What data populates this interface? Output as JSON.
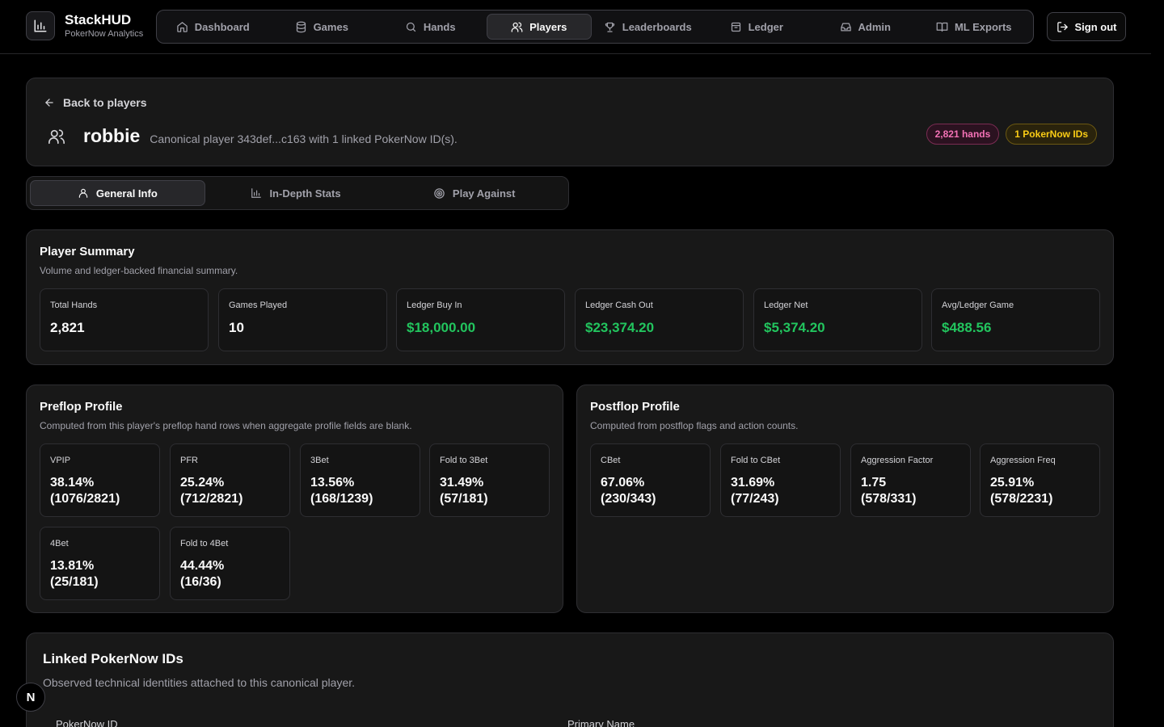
{
  "brand": {
    "title": "StackHUD",
    "subtitle": "PokerNow Analytics"
  },
  "nav": {
    "items": [
      {
        "label": "Dashboard",
        "icon": "home-icon"
      },
      {
        "label": "Games",
        "icon": "database-icon"
      },
      {
        "label": "Hands",
        "icon": "search-icon"
      },
      {
        "label": "Players",
        "icon": "users-icon",
        "active": true
      },
      {
        "label": "Leaderboards",
        "icon": "trophy-icon"
      },
      {
        "label": "Ledger",
        "icon": "wallet-icon"
      },
      {
        "label": "Admin",
        "icon": "inbox-icon"
      },
      {
        "label": "ML Exports",
        "icon": "book-icon"
      }
    ],
    "sign_out": "Sign out"
  },
  "hero": {
    "back_label": "Back to players",
    "player_name": "robbie",
    "description": "Canonical player 343def...c163 with 1 linked PokerNow ID(s).",
    "badge_hands": "2,821 hands",
    "badge_ids": "1 PokerNow IDs"
  },
  "tabs": [
    {
      "label": "General Info",
      "icon": "user-icon",
      "active": true
    },
    {
      "label": "In-Depth Stats",
      "icon": "bar-chart-icon"
    },
    {
      "label": "Play Against",
      "icon": "target-icon"
    }
  ],
  "summary": {
    "title": "Player Summary",
    "subtitle": "Volume and ledger-backed financial summary.",
    "stats": [
      {
        "label": "Total Hands",
        "value": "2,821"
      },
      {
        "label": "Games Played",
        "value": "10"
      },
      {
        "label": "Ledger Buy In",
        "value": "$18,000.00"
      },
      {
        "label": "Ledger Cash Out",
        "value": "$23,374.20"
      },
      {
        "label": "Ledger Net",
        "value": "$5,374.20"
      },
      {
        "label": "Avg/Ledger Game",
        "value": "$488.56"
      }
    ]
  },
  "preflop": {
    "title": "Preflop Profile",
    "subtitle": "Computed from this player's preflop hand rows when aggregate profile fields are blank.",
    "stats": [
      {
        "label": "VPIP",
        "line1": "38.14%",
        "line2": "(1076/2821)"
      },
      {
        "label": "PFR",
        "line1": "25.24%",
        "line2": "(712/2821)"
      },
      {
        "label": "3Bet",
        "line1": "13.56%",
        "line2": "(168/1239)"
      },
      {
        "label": "Fold to 3Bet",
        "line1": "31.49%",
        "line2": "(57/181)"
      },
      {
        "label": "4Bet",
        "line1": "13.81%",
        "line2": "(25/181)"
      },
      {
        "label": "Fold to 4Bet",
        "line1": "44.44%",
        "line2": "(16/36)"
      }
    ]
  },
  "postflop": {
    "title": "Postflop Profile",
    "subtitle": "Computed from postflop flags and action counts.",
    "stats": [
      {
        "label": "CBet",
        "line1": "67.06%",
        "line2": "(230/343)"
      },
      {
        "label": "Fold to CBet",
        "line1": "31.69%",
        "line2": "(77/243)"
      },
      {
        "label": "Aggression Factor",
        "line1": "1.75",
        "line2": "(578/331)"
      },
      {
        "label": "Aggression Freq",
        "line1": "25.91%",
        "line2": "(578/2231)"
      }
    ]
  },
  "linked": {
    "title": "Linked PokerNow IDs",
    "subtitle": "Observed technical identities attached to this canonical player.",
    "col_id": "PokerNow ID",
    "col_name": "Primary Name"
  },
  "next_badge": "N",
  "colors": {
    "accent_green": "#22c55e",
    "badge_pink": "#f472b6",
    "badge_yellow": "#facc15"
  }
}
